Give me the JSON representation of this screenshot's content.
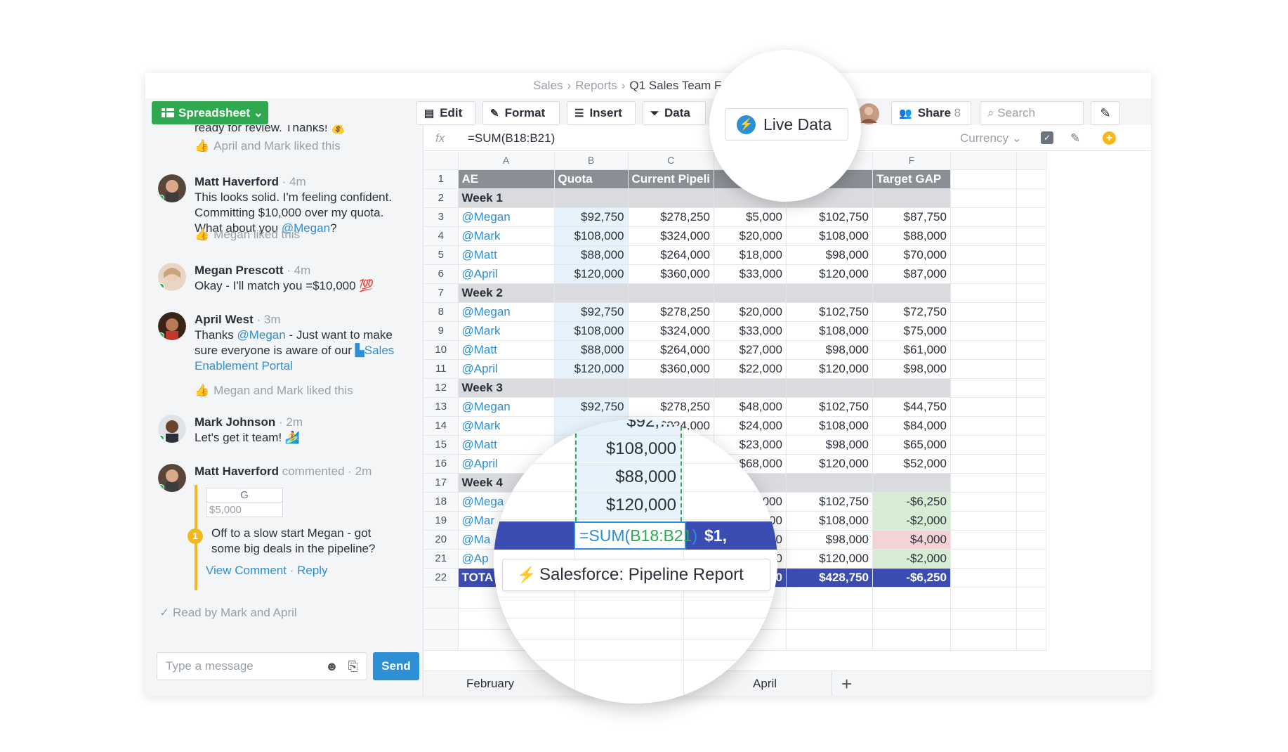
{
  "breadcrumb": {
    "items": [
      "Sales",
      "Reports"
    ],
    "current": "Q1 Sales Team Forecasti"
  },
  "toolbar": {
    "spreadsheet_label": "Spreadsheet",
    "edit_label": "Edit",
    "format_label": "Format",
    "insert_label": "Insert",
    "data_label": "Data",
    "share_label": "Share",
    "share_count": "8",
    "search_placeholder": "Search"
  },
  "live_data_label": "Live Data",
  "chat": {
    "top_snippet": "ready for review. Thanks! 💰",
    "top_liked": "April and Mark liked this",
    "messages": [
      {
        "name": "Matt Haverford",
        "time": "· 4m",
        "text_before": "This looks solid. I'm feeling confident. Committing $10,000 over my quota. What about you ",
        "mention": "@Megan",
        "text_after": "?",
        "liked": "Megan liked this"
      },
      {
        "name": "Megan Prescott",
        "time": "· 4m",
        "text": "Okay - I'll match you =$10,000 💯"
      },
      {
        "name": "April West",
        "time": "· 3m",
        "text_a": "Thanks ",
        "mention": "@Megan",
        "text_b": " - Just want to make sure everyone is aware of our ",
        "link": "Sales Enablement Portal",
        "liked": "Megan and Mark liked this"
      },
      {
        "name": "Mark Johnson",
        "time": "· 2m",
        "text": "Let's get it team! 🏄"
      },
      {
        "name": "Matt Haverford",
        "time": "commented · 2m",
        "cell_col": "G",
        "cell_val": "$5,000",
        "badge": "1",
        "comment": "Off to a slow start Megan - got some big deals in the pipeline?",
        "view_comment": "View Comment",
        "reply": "Reply"
      }
    ],
    "read_by": "Read by Mark and April",
    "input_placeholder": "Type a message",
    "send_label": "Send"
  },
  "formula": {
    "fx": "fx",
    "value": "=SUM(B18:B21)",
    "format": "Currency"
  },
  "sheet": {
    "col_letters": [
      "A",
      "B",
      "C",
      "D",
      "E",
      "F"
    ],
    "headers": [
      "AE",
      "Quota",
      "Current Pipeli",
      "",
      "Commit",
      "Target GAP"
    ],
    "rows": [
      {
        "n": "2",
        "type": "week",
        "cells": [
          "Week 1",
          "",
          "",
          "",
          "",
          ""
        ]
      },
      {
        "n": "3",
        "type": "data",
        "cells": [
          "@Megan",
          "$92,750",
          "$278,250",
          "$5,000",
          "$102,750",
          "$87,750"
        ]
      },
      {
        "n": "4",
        "type": "data",
        "cells": [
          "@Mark",
          "$108,000",
          "$324,000",
          "$20,000",
          "$108,000",
          "$88,000"
        ]
      },
      {
        "n": "5",
        "type": "data",
        "cells": [
          "@Matt",
          "$88,000",
          "$264,000",
          "$18,000",
          "$98,000",
          "$70,000"
        ]
      },
      {
        "n": "6",
        "type": "data",
        "cells": [
          "@April",
          "$120,000",
          "$360,000",
          "$33,000",
          "$120,000",
          "$87,000"
        ]
      },
      {
        "n": "7",
        "type": "week",
        "cells": [
          "Week 2",
          "",
          "",
          "",
          "",
          ""
        ]
      },
      {
        "n": "8",
        "type": "data",
        "cells": [
          "@Megan",
          "$92,750",
          "$278,250",
          "$20,000",
          "$102,750",
          "$72,750"
        ]
      },
      {
        "n": "9",
        "type": "data",
        "cells": [
          "@Mark",
          "$108,000",
          "$324,000",
          "$33,000",
          "$108,000",
          "$75,000"
        ]
      },
      {
        "n": "10",
        "type": "data",
        "cells": [
          "@Matt",
          "$88,000",
          "$264,000",
          "$27,000",
          "$98,000",
          "$61,000"
        ]
      },
      {
        "n": "11",
        "type": "data",
        "cells": [
          "@April",
          "$120,000",
          "$360,000",
          "$22,000",
          "$120,000",
          "$98,000"
        ]
      },
      {
        "n": "12",
        "type": "week",
        "cells": [
          "Week 3",
          "",
          "",
          "",
          "",
          ""
        ]
      },
      {
        "n": "13",
        "type": "data",
        "cells": [
          "@Megan",
          "$92,750",
          "$278,250",
          "$48,000",
          "$102,750",
          "$44,750"
        ]
      },
      {
        "n": "14",
        "type": "data",
        "cells": [
          "@Mark",
          "",
          "$324,000",
          "$24,000",
          "$108,000",
          "$84,000"
        ]
      },
      {
        "n": "15",
        "type": "data",
        "cells": [
          "@Matt",
          "",
          "",
          "$23,000",
          "$98,000",
          "$65,000"
        ]
      },
      {
        "n": "16",
        "type": "data",
        "cells": [
          "@April",
          "",
          "",
          "$68,000",
          "$120,000",
          "$52,000"
        ]
      },
      {
        "n": "17",
        "type": "week",
        "cells": [
          "Week 4",
          "",
          "",
          "",
          "",
          ""
        ]
      },
      {
        "n": "18",
        "type": "data",
        "cells": [
          "@Mega",
          "",
          "",
          "$99,000",
          "$102,750",
          "-$6,250"
        ],
        "gap": "neg"
      },
      {
        "n": "19",
        "type": "data",
        "cells": [
          "@Mar",
          "",
          "",
          "$110,000",
          "$108,000",
          "-$2,000"
        ],
        "gap": "neg"
      },
      {
        "n": "20",
        "type": "data",
        "cells": [
          "@Ma",
          "",
          "",
          "$84,000",
          "$98,000",
          "$4,000"
        ],
        "gap": "pos"
      },
      {
        "n": "21",
        "type": "data",
        "cells": [
          "@Ap",
          "",
          "",
          "$122,000",
          "$120,000",
          "-$2,000"
        ],
        "gap": "neg"
      },
      {
        "n": "22",
        "type": "total",
        "cells": [
          "TOTA",
          "",
          "",
          "$415,000",
          "$428,750",
          "-$6,250"
        ]
      }
    ],
    "tabs": [
      "February",
      "April"
    ]
  },
  "zoom": {
    "top_partial": "$92,…",
    "cells": [
      "$108,000",
      "$88,000",
      "$120,000"
    ],
    "formula_prefix": "=SUM(",
    "formula_range": "B18:B21",
    "formula_suffix": ")",
    "right_value": "$1,",
    "pill_label": "Salesforce: Pipeline Report"
  },
  "colors": {
    "green": "#2fa84f",
    "blue": "#2d8fd5",
    "total": "#3b4db3"
  }
}
